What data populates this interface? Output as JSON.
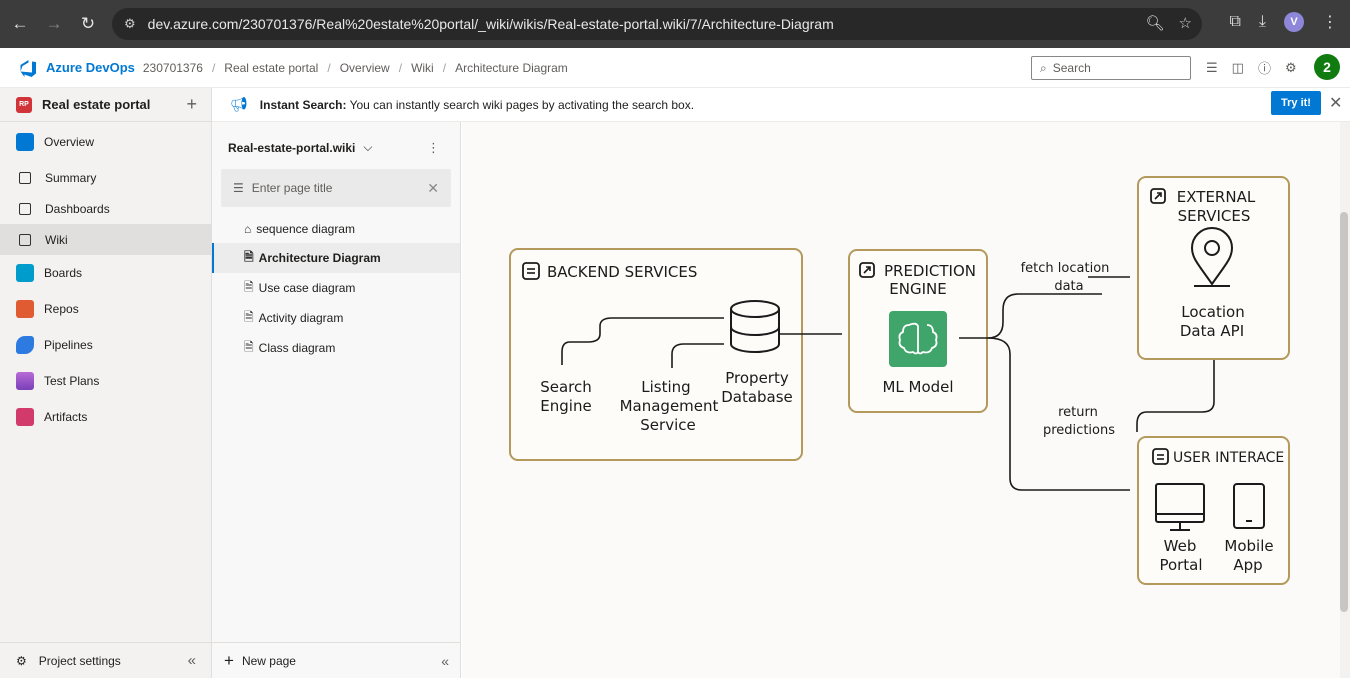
{
  "browser": {
    "url": "dev.azure.com/230701376/Real%20estate%20portal/_wiki/wikis/Real-estate-portal.wiki/7/Architecture-Diagram",
    "profile_initial": "V"
  },
  "header": {
    "brand": "Azure DevOps",
    "breadcrumbs": [
      "230701376",
      "Real estate portal",
      "Overview",
      "Wiki",
      "Architecture Diagram"
    ],
    "search_placeholder": "Search",
    "avatar_badge": "2"
  },
  "sidebar": {
    "project_badge": "RP",
    "project_name": "Real estate portal",
    "items": [
      {
        "label": "Overview"
      },
      {
        "label": "Summary"
      },
      {
        "label": "Dashboards"
      },
      {
        "label": "Wiki"
      },
      {
        "label": "Boards"
      },
      {
        "label": "Repos"
      },
      {
        "label": "Pipelines"
      },
      {
        "label": "Test Plans"
      },
      {
        "label": "Artifacts"
      }
    ],
    "project_settings": "Project settings"
  },
  "banner": {
    "title": "Instant Search:",
    "text": " You can instantly search wiki pages by activating the search box.",
    "try_label": "Try it!"
  },
  "wiki": {
    "name": "Real-estate-portal.wiki",
    "filter_placeholder": "Enter page title",
    "pages": [
      "sequence diagram",
      "Architecture Diagram",
      "Use case diagram",
      "Activity diagram",
      "Class diagram"
    ],
    "new_page": "New page"
  },
  "diagram": {
    "backend": {
      "title": "BACKEND SERVICES",
      "search_line1": "Search",
      "search_line2": "Engine",
      "listing_line1": "Listing",
      "listing_line2": "Management",
      "listing_line3": "Service",
      "db_line1": "Property",
      "db_line2": "Database"
    },
    "prediction": {
      "title_line1": "PREDICTION",
      "title_line2": "ENGINE",
      "model": "ML Model"
    },
    "external": {
      "title_line1": "EXTERNAL",
      "title_line2": "SERVICES",
      "api_line1": "Location",
      "api_line2": "Data API"
    },
    "user": {
      "title": "USER INTERACE",
      "web_line1": "Web",
      "web_line2": "Portal",
      "mobile_line1": "Mobile",
      "mobile_line2": "App"
    },
    "arrows": {
      "fetch_line1": "fetch location",
      "fetch_line2": "data",
      "return_line1": "return",
      "return_line2": "predictions"
    },
    "colors": {
      "box_border": "#b39a5c",
      "ml_green": "#3fa56b"
    }
  }
}
